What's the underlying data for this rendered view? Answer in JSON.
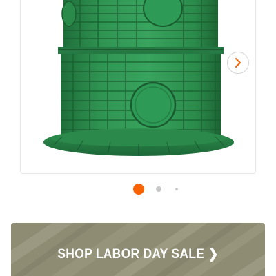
{
  "gallery": {
    "image_alt": "Green plastic septic riser tank",
    "next_icon": "chevron-right-icon",
    "active_slide": 1,
    "slide_dots": 3
  },
  "promo": {
    "label": "SHOP LABOR DAY SALE",
    "chevron": "❯",
    "chevron_icon": "chevron-right-icon"
  },
  "colors": {
    "accent": "#f96302",
    "dot_inactive": "#c8c8c8",
    "banner_bg": "#8e8c73",
    "product_green": "#2e8f4e"
  }
}
